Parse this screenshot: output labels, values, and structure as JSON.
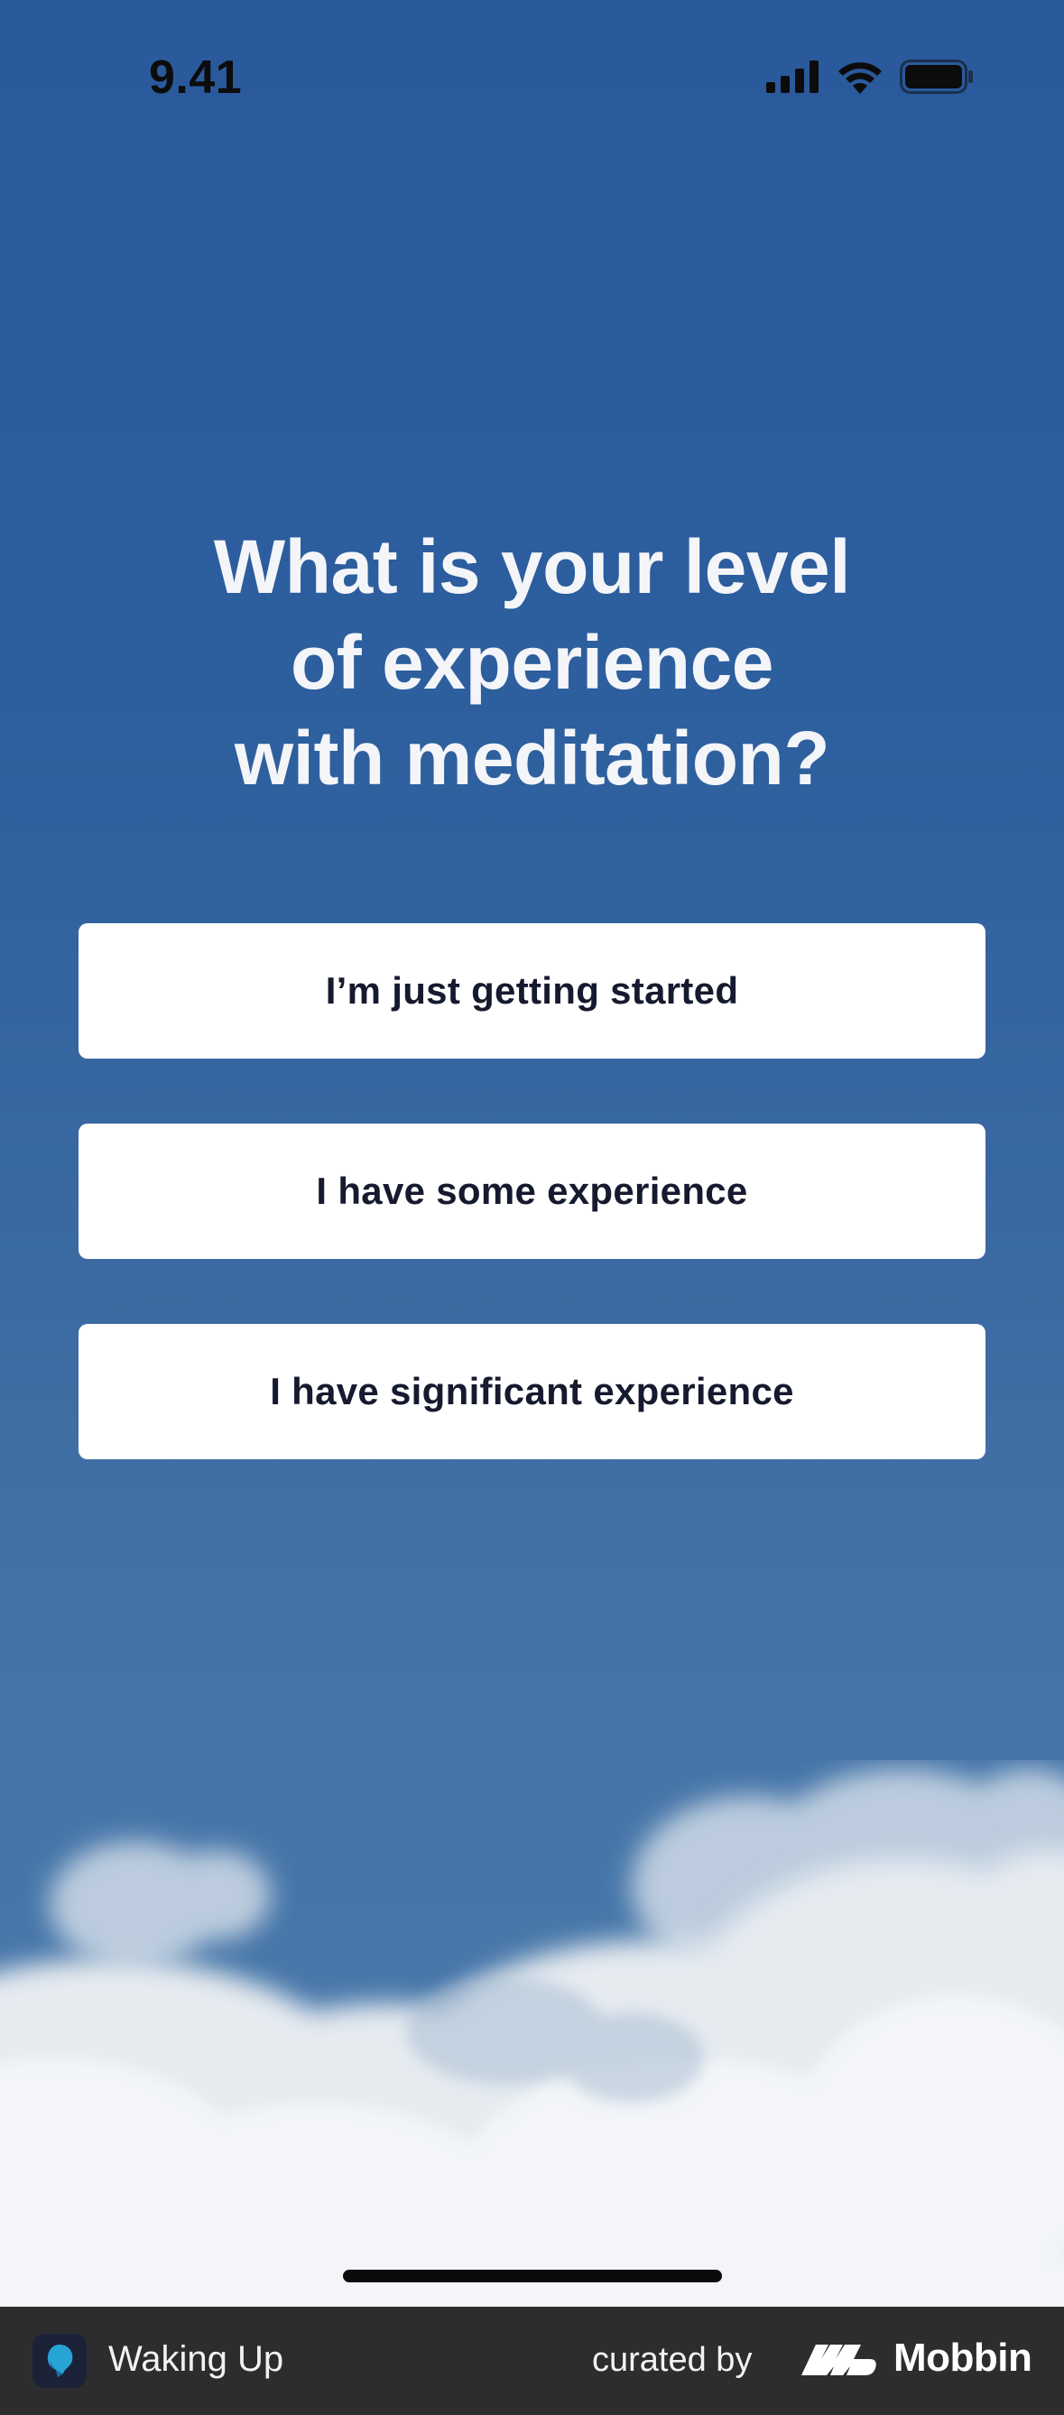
{
  "status_bar": {
    "time": "9.41",
    "icons": [
      "cellular-signal-icon",
      "wifi-icon",
      "battery-icon"
    ]
  },
  "question": {
    "line1": "What is your level",
    "line2": "of experience",
    "line3": "with meditation?"
  },
  "options": [
    {
      "label": "I’m just getting started"
    },
    {
      "label": "I have some experience"
    },
    {
      "label": "I have significant experience"
    }
  ],
  "footer": {
    "app_name": "Waking Up",
    "curated_by": "curated by",
    "brand": "Mobbin"
  },
  "colors": {
    "background_top": "#2a5a9c",
    "background_bottom": "#4a79aa",
    "title_text": "#f4f5f8",
    "button_bg": "#ffffff",
    "button_text": "#161a2e",
    "footer_bg": "#2d2d2d"
  }
}
